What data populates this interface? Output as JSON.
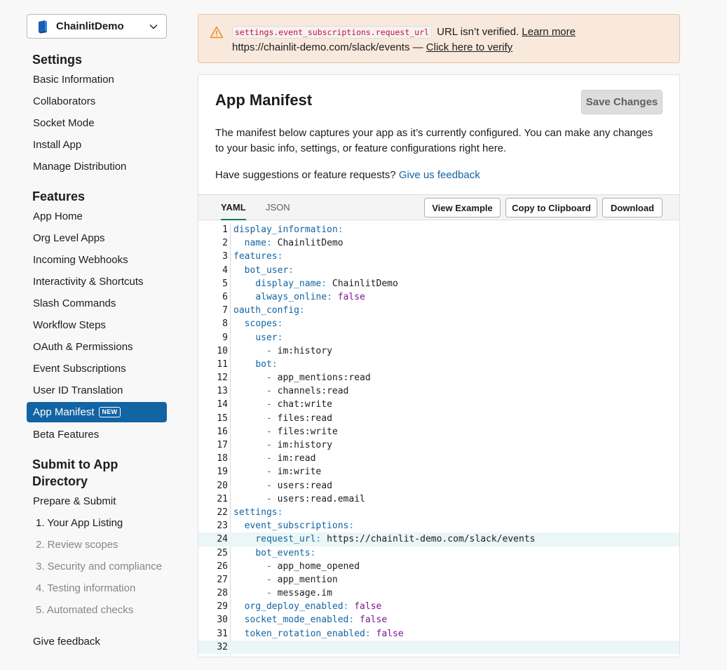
{
  "app_selector": {
    "name": "ChainlitDemo"
  },
  "sidebar": {
    "settings_title": "Settings",
    "settings_items": [
      "Basic Information",
      "Collaborators",
      "Socket Mode",
      "Install App",
      "Manage Distribution"
    ],
    "features_title": "Features",
    "features_items": [
      "App Home",
      "Org Level Apps",
      "Incoming Webhooks",
      "Interactivity & Shortcuts",
      "Slash Commands",
      "Workflow Steps",
      "OAuth & Permissions",
      "Event Subscriptions",
      "User ID Translation",
      "App Manifest",
      "Beta Features"
    ],
    "active_item": "App Manifest",
    "new_badge": "NEW",
    "submit_title_1": "Submit to App",
    "submit_title_2": "Directory",
    "submit_items": [
      "Prepare & Submit",
      "1. Your App Listing",
      "2. Review scopes",
      "3. Security and compliance",
      "4. Testing information",
      "5. Automated checks"
    ],
    "give_feedback": "Give feedback"
  },
  "banner": {
    "code": "settings.event_subscriptions.request_url",
    "text1": " URL isn’t verified. ",
    "learn_more": "Learn more",
    "url_text": "https://chainlit-demo.com/slack/events — ",
    "verify_link": "Click here to verify"
  },
  "main": {
    "title": "App Manifest",
    "save_label": "Save Changes",
    "description": "The manifest below captures your app as it’s currently configured. You can make any changes to your basic info, settings, or feature configurations right here.",
    "suggest_text": "Have suggestions or feature requests? ",
    "feedback_link": "Give us feedback",
    "tabs": [
      "YAML",
      "JSON"
    ],
    "active_tab": "YAML",
    "buttons": {
      "view_example": "View Example",
      "copy": "Copy to Clipboard",
      "download": "Download"
    }
  },
  "manifest_lines": [
    {
      "n": "1",
      "indent": "",
      "key": "display_information",
      "val": "",
      "type": ""
    },
    {
      "n": "2",
      "indent": "  ",
      "key": "name",
      "val": "ChainlitDemo",
      "type": "str"
    },
    {
      "n": "3",
      "indent": "",
      "key": "features",
      "val": "",
      "type": ""
    },
    {
      "n": "4",
      "indent": "  ",
      "key": "bot_user",
      "val": "",
      "type": ""
    },
    {
      "n": "5",
      "indent": "    ",
      "key": "display_name",
      "val": "ChainlitDemo",
      "type": "str"
    },
    {
      "n": "6",
      "indent": "    ",
      "key": "always_online",
      "val": "false",
      "type": "bool"
    },
    {
      "n": "7",
      "indent": "",
      "key": "oauth_config",
      "val": "",
      "type": ""
    },
    {
      "n": "8",
      "indent": "  ",
      "key": "scopes",
      "val": "",
      "type": ""
    },
    {
      "n": "9",
      "indent": "    ",
      "key": "user",
      "val": "",
      "type": ""
    },
    {
      "n": "10",
      "indent": "      ",
      "item": "im:history"
    },
    {
      "n": "11",
      "indent": "    ",
      "key": "bot",
      "val": "",
      "type": ""
    },
    {
      "n": "12",
      "indent": "      ",
      "item": "app_mentions:read"
    },
    {
      "n": "13",
      "indent": "      ",
      "item": "channels:read"
    },
    {
      "n": "14",
      "indent": "      ",
      "item": "chat:write"
    },
    {
      "n": "15",
      "indent": "      ",
      "item": "files:read"
    },
    {
      "n": "16",
      "indent": "      ",
      "item": "files:write"
    },
    {
      "n": "17",
      "indent": "      ",
      "item": "im:history"
    },
    {
      "n": "18",
      "indent": "      ",
      "item": "im:read"
    },
    {
      "n": "19",
      "indent": "      ",
      "item": "im:write"
    },
    {
      "n": "20",
      "indent": "      ",
      "item": "users:read"
    },
    {
      "n": "21",
      "indent": "      ",
      "item": "users:read.email"
    },
    {
      "n": "22",
      "indent": "",
      "key": "settings",
      "val": "",
      "type": ""
    },
    {
      "n": "23",
      "indent": "  ",
      "key": "event_subscriptions",
      "val": "",
      "type": ""
    },
    {
      "n": "24",
      "indent": "    ",
      "key": "request_url",
      "val": "https://chainlit-demo.com/slack/events",
      "type": "str",
      "highlight": true
    },
    {
      "n": "25",
      "indent": "    ",
      "key": "bot_events",
      "val": "",
      "type": ""
    },
    {
      "n": "26",
      "indent": "      ",
      "item": "app_home_opened"
    },
    {
      "n": "27",
      "indent": "      ",
      "item": "app_mention"
    },
    {
      "n": "28",
      "indent": "      ",
      "item": "message.im"
    },
    {
      "n": "29",
      "indent": "  ",
      "key": "org_deploy_enabled",
      "val": "false",
      "type": "bool"
    },
    {
      "n": "30",
      "indent": "  ",
      "key": "socket_mode_enabled",
      "val": "false",
      "type": "bool"
    },
    {
      "n": "31",
      "indent": "  ",
      "key": "token_rotation_enabled",
      "val": "false",
      "type": "bool"
    },
    {
      "n": "32",
      "indent": "",
      "empty": true,
      "highlight": true
    }
  ],
  "colors": {
    "accent": "#1264a3",
    "tab_underline": "#007a5a",
    "banner_bg": "#f8e9dc",
    "bool": "#7a1a8f"
  }
}
